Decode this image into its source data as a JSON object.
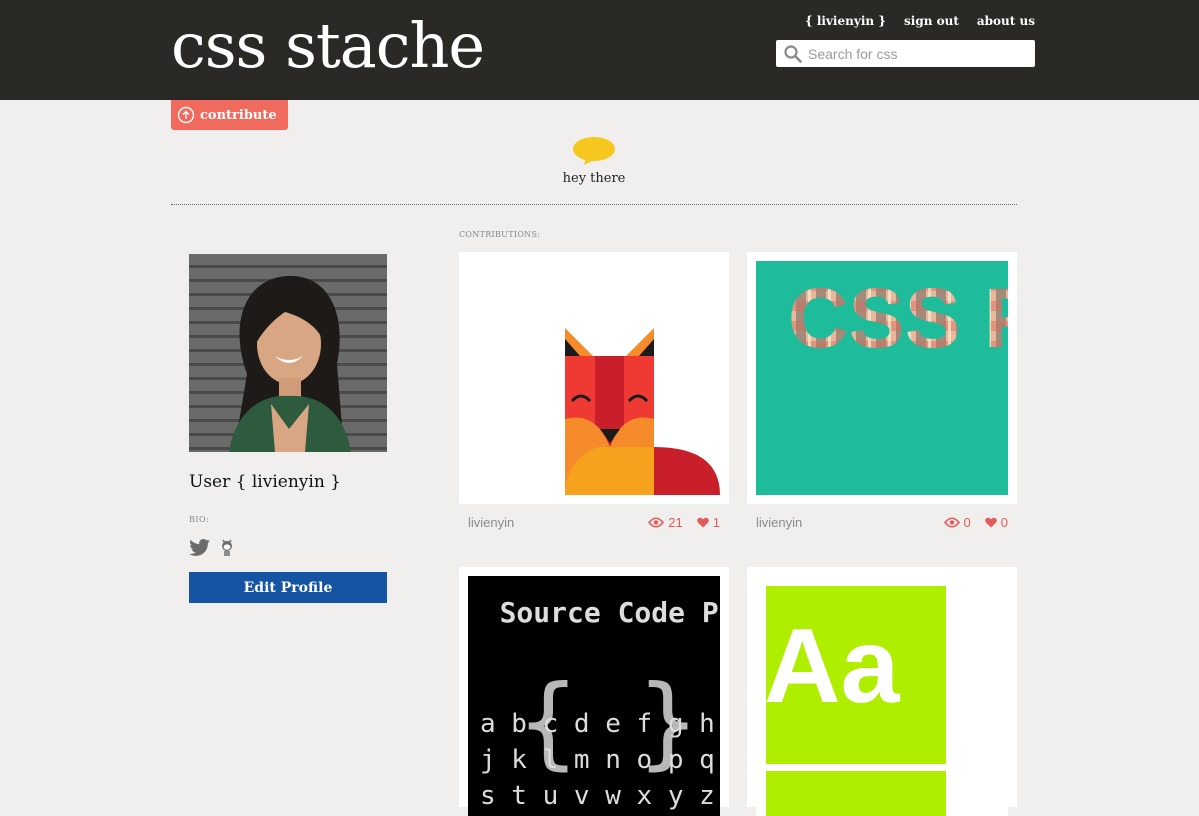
{
  "header": {
    "logo": "css stache",
    "nav": [
      {
        "label": "{ livienyin }"
      },
      {
        "label": "sign out"
      },
      {
        "label": "about us"
      }
    ],
    "search_placeholder": "Search for css"
  },
  "contribute_label": "contribute",
  "greeting": "hey there",
  "profile": {
    "username": "User { livienyin }",
    "bio_label": "BIO:",
    "edit_label": "Edit Profile"
  },
  "contributions_label": "CONTRIBUTIONS:",
  "cards": [
    {
      "author": "livienyin",
      "views": "21",
      "likes": "1",
      "title": ""
    },
    {
      "author": "livienyin",
      "views": "0",
      "likes": "0",
      "title": "CSS Patter"
    },
    {
      "title": "Source Code Pro",
      "glyph_rows": [
        "a b c d e f g h",
        "j k l m n o p q",
        "s t u v w x y z"
      ]
    },
    {
      "title": "Aa"
    }
  ],
  "colors": {
    "header_bg": "#2b2925",
    "accent_red": "#f06b5e",
    "button_blue": "#1553a3",
    "bubble_yellow": "#f6c71f",
    "teal": "#1fbc9c",
    "lime": "#b0ee00"
  }
}
